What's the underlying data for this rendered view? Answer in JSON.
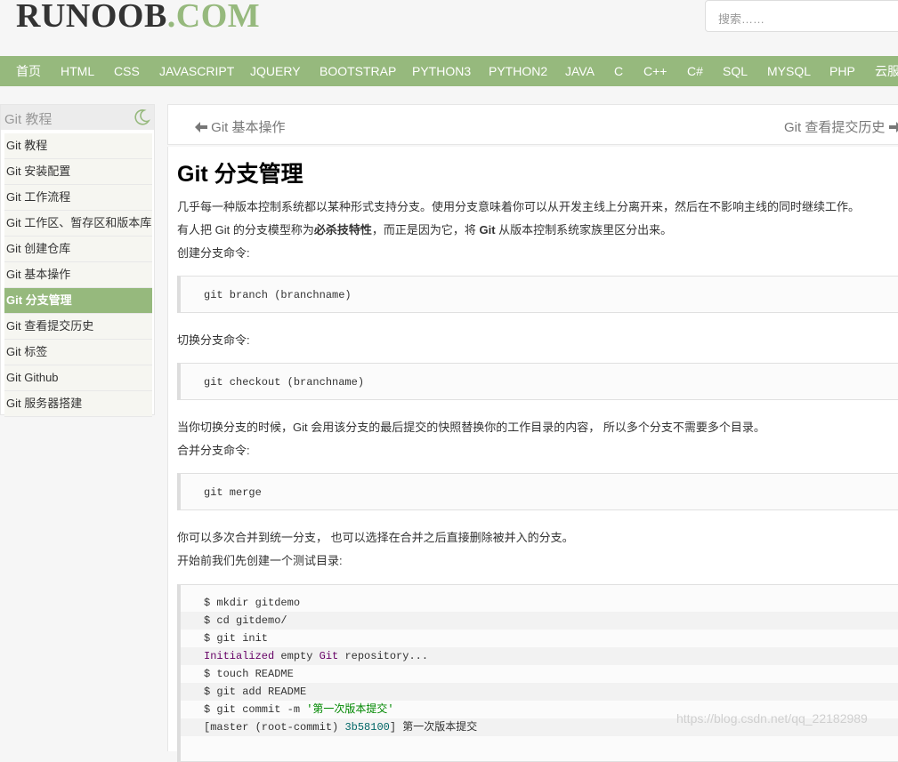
{
  "header": {
    "logo_main": "RUNOOB",
    "logo_suffix": ".COM",
    "search_placeholder": "搜索……"
  },
  "nav": [
    "首页",
    "HTML",
    "CSS",
    "JAVASCRIPT",
    "JQUERY",
    "BOOTSTRAP",
    "PYTHON3",
    "PYTHON2",
    "JAVA",
    "C",
    "C++",
    "C#",
    "SQL",
    "MYSQL",
    "PHP",
    "云服"
  ],
  "sidebar": {
    "title": "Git 教程",
    "items": [
      {
        "label": "Git 教程",
        "active": false
      },
      {
        "label": "Git 安装配置",
        "active": false
      },
      {
        "label": "Git 工作流程",
        "active": false
      },
      {
        "label": "Git 工作区、暂存区和版本库",
        "active": false
      },
      {
        "label": "Git 创建仓库",
        "active": false
      },
      {
        "label": "Git 基本操作",
        "active": false
      },
      {
        "label": "Git 分支管理",
        "active": true
      },
      {
        "label": "Git 查看提交历史",
        "active": false
      },
      {
        "label": "Git 标签",
        "active": false
      },
      {
        "label": "Git Github",
        "active": false
      },
      {
        "label": "Git 服务器搭建",
        "active": false
      }
    ]
  },
  "pager": {
    "prev": "Git 基本操作",
    "next": "Git 查看提交历史"
  },
  "article": {
    "title": "Git 分支管理",
    "p1": "几乎每一种版本控制系统都以某种形式支持分支。使用分支意味着你可以从开发主线上分离开来，然后在不影响主线的同时继续工作。",
    "p2a": "有人把 Git 的分支模型称为",
    "p2b": "必杀技特性",
    "p2c": "，而正是因为它，将 ",
    "p2d": "Git",
    "p2e": " 从版本控制系统家族里区分出来。",
    "p3": "创建分支命令:",
    "code1": "git branch (branchname)",
    "p4": "切换分支命令:",
    "code2": "git checkout (branchname)",
    "p5": "当你切换分支的时候，Git 会用该分支的最后提交的快照替换你的工作目录的内容， 所以多个分支不需要多个目录。",
    "p6": "合并分支命令:",
    "code3": "git merge",
    "p7": "你可以多次合并到统一分支， 也可以选择在合并之后直接删除被并入的分支。",
    "p8": "开始前我们先创建一个测试目录:",
    "code4": [
      "$ mkdir gitdemo",
      "$ cd gitdemo/",
      "$ git init",
      "Initialized empty Git repository...",
      "$ touch README",
      "$ git add README",
      "$ git commit -m '第一次版本提交'",
      "[master (root-commit) 3b58100] 第一次版本提交"
    ]
  },
  "watermark": "https://blog.csdn.net/qq_22182989"
}
